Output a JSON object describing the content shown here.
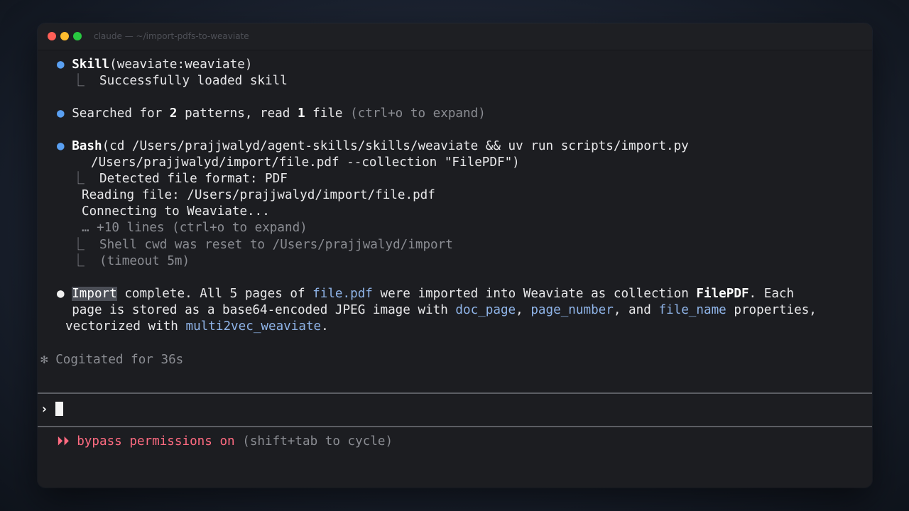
{
  "window": {
    "title": "claude — ~/import-pdfs-to-weaviate"
  },
  "blocks": {
    "skill": {
      "bullet": "●",
      "tool": "Skill",
      "args": "(weaviate:weaviate)",
      "result_branch": "⎿",
      "result": "Successfully loaded skill"
    },
    "search": {
      "bullet": "●",
      "pre": "Searched for ",
      "count_patterns": "2",
      "mid": " patterns, read ",
      "count_files": "1",
      "post": " file ",
      "hint": "(ctrl+o to expand)"
    },
    "bash": {
      "bullet": "●",
      "tool": "Bash",
      "cmd_line1": "(cd /Users/prajjwalyd/agent-skills/skills/weaviate && uv run scripts/import.py",
      "cmd_line2": "/Users/prajjwalyd/import/file.pdf --collection \"FilePDF\")",
      "branch": "⎿",
      "out1": "Detected file format: PDF",
      "out2": "Reading file: /Users/prajjwalyd/import/file.pdf",
      "out3": "Connecting to Weaviate...",
      "more": "… +10 lines (ctrl+o to expand)",
      "note1": "Shell cwd was reset to /Users/prajjwalyd/import",
      "note2": "(timeout 5m)"
    },
    "message": {
      "bullet": "●",
      "word_selected": "Import",
      "l1_a": " complete. All 5 pages of ",
      "l1_code": "file.pdf",
      "l1_b": " were imported into Weaviate as collection ",
      "l1_bold": "FilePDF",
      "l1_c": ". Each",
      "l2_a": "page is stored as a base64-encoded JPEG image with ",
      "l2_code1": "doc_page",
      "l2_sep1": ", ",
      "l2_code2": "page_number",
      "l2_sep2": ", and ",
      "l2_code3": "file_name",
      "l2_b": " properties,",
      "l3_a": "vectorized with ",
      "l3_code": "multi2vec_weaviate",
      "l3_b": "."
    },
    "status": {
      "star": "✻",
      "text": "Cogitated for 36s"
    }
  },
  "prompt": {
    "symbol": "›",
    "value": ""
  },
  "footer": {
    "arrows": "⏵⏵",
    "mode": "bypass permissions on",
    "hint": "(shift+tab to cycle)"
  },
  "colors": {
    "accent_blue": "#5aa0f2",
    "code_blue": "#8fb4e8",
    "mode_red": "#ff6b81",
    "background": "#1c1d21"
  }
}
